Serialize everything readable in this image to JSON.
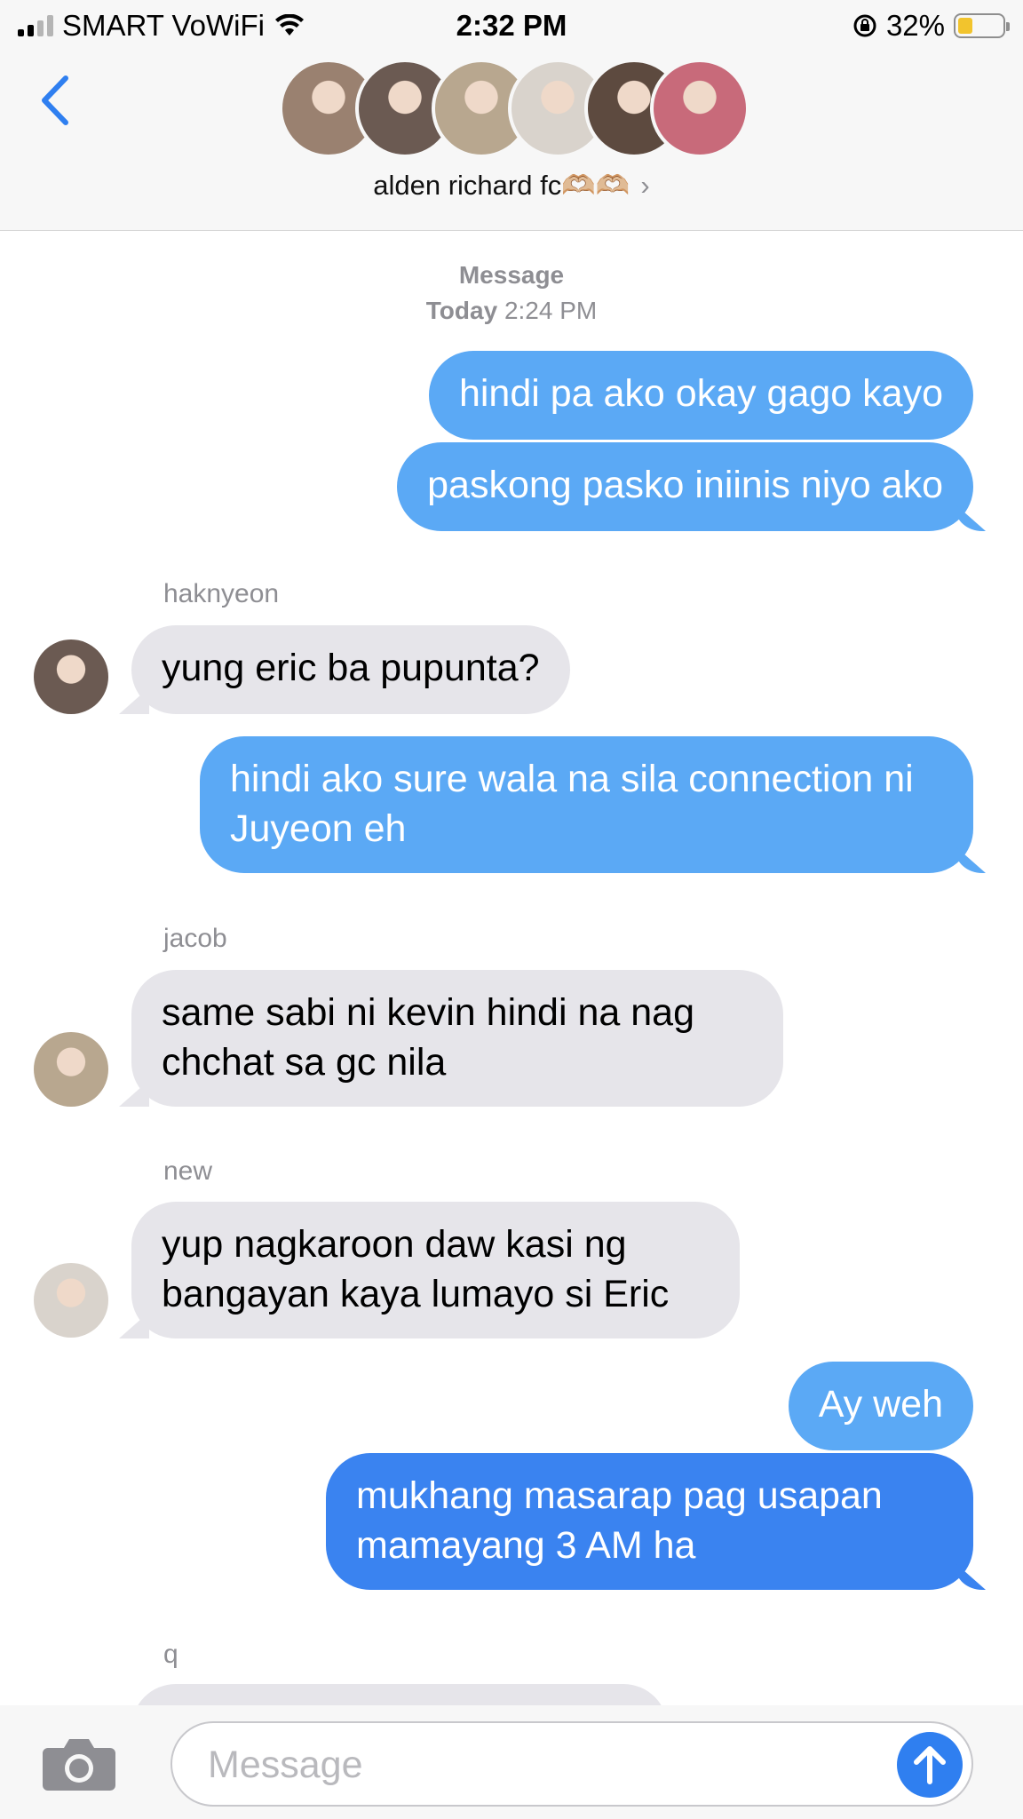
{
  "status_bar": {
    "carrier": "SMART VoWiFi",
    "time": "2:32 PM",
    "battery_percent": "32%",
    "battery_level": 0.32
  },
  "header": {
    "group_name": "alden richard fc🫶🏼🫶🏼",
    "chevron": "›",
    "avatar_colors": [
      "#9a8170",
      "#6b5a52",
      "#b8a78f",
      "#d9d3cc",
      "#5d4a3f",
      "#c86a7a"
    ]
  },
  "thread": {
    "meta_label": "Message",
    "meta_day": "Today",
    "meta_time": "2:24 PM",
    "messages": [
      {
        "direction": "outgoing",
        "text": "hindi pa ako okay gago kayo"
      },
      {
        "direction": "outgoing",
        "text": "paskong pasko iniinis niyo ako"
      },
      {
        "direction": "incoming",
        "sender": "haknyeon",
        "text": "yung eric ba pupunta?"
      },
      {
        "direction": "outgoing",
        "text": "hindi ako sure wala na sila connection ni Juyeon eh"
      },
      {
        "direction": "incoming",
        "sender": "jacob",
        "text": "same sabi ni kevin hindi na nag chchat sa gc nila"
      },
      {
        "direction": "incoming",
        "sender": "new",
        "text": "yup nagkaroon daw kasi ng bangayan kaya lumayo si Eric"
      },
      {
        "direction": "outgoing",
        "text": "Ay weh"
      },
      {
        "direction": "outgoing",
        "text": "mukhang masarap pag usapan mamayang 3 AM ha"
      },
      {
        "direction": "incoming",
        "sender": "q",
        "text": ""
      }
    ]
  },
  "composer": {
    "placeholder": "Message",
    "camera_icon": "camera-icon",
    "send_icon": "arrow-up-icon"
  },
  "colors": {
    "outgoing_bubble": "#5ba9f5",
    "outgoing_bubble_latest": "#3a83f0",
    "incoming_bubble": "#e6e5ea",
    "accent": "#2f7ff0"
  }
}
